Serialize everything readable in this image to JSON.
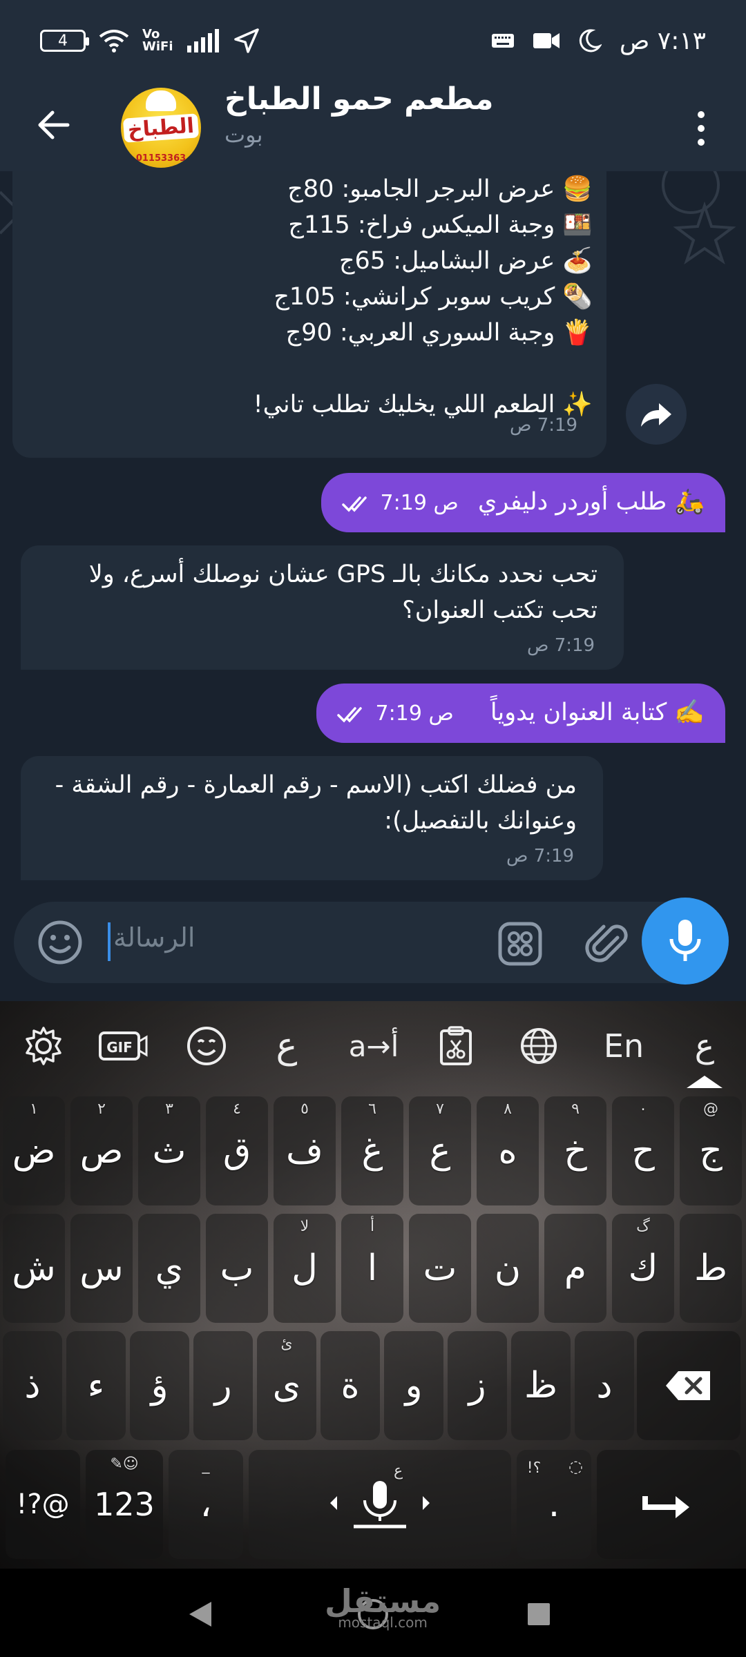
{
  "status_bar": {
    "time": "٧:١٣ ص",
    "battery": "4",
    "vowifi": "Vo\nWiFi"
  },
  "header": {
    "title": "مطعم حمو الطباخ",
    "subtitle": "بوت",
    "avatar_text": "الطباخ",
    "avatar_phone": "01153363"
  },
  "messages": {
    "menu": {
      "lines": [
        "🍔 عرض البرجر الجامبو: 80ج",
        "🍱 وجبة الميكس فراخ: 115ج",
        "🍝 عرض البشاميل: 65ج",
        "🌯 كريب سوبر كرانشي: 105ج",
        "🍟 وجبة السوري العربي: 90ج",
        "✨ الطعم اللي يخليك تطلب تاني!"
      ],
      "time": "7:19 ص"
    },
    "order": {
      "text": "🛵 طلب أوردر دليفري",
      "time": "7:19 ص"
    },
    "gps": {
      "lines": [
        "تحب نحدد مكانك بالـ GPS عشان نوصلك أسرع، ولا",
        "تحب تكتب العنوان؟"
      ],
      "time": "7:19 ص"
    },
    "manual": {
      "text": "✍️ كتابة العنوان يدوياً",
      "time": "7:19 ص"
    },
    "details": {
      "lines": [
        "من فضلك اكتب (الاسم - رقم العمارة - رقم الشقة -",
        "وعنوانك بالتفصيل):"
      ],
      "time": "7:19 ص"
    }
  },
  "composer": {
    "placeholder": "الرسالة"
  },
  "keyboard": {
    "toolbar": {
      "translate": "a→أ",
      "lang": "En",
      "ain": "ع",
      "ain2": "ع"
    },
    "row1": [
      {
        "k": "ض",
        "h": "١"
      },
      {
        "k": "ص",
        "h": "٢"
      },
      {
        "k": "ث",
        "h": "٣"
      },
      {
        "k": "ق",
        "h": "٤"
      },
      {
        "k": "ف",
        "h": "٥"
      },
      {
        "k": "غ",
        "h": "٦"
      },
      {
        "k": "ع",
        "h": "٧"
      },
      {
        "k": "ه",
        "h": "٨"
      },
      {
        "k": "خ",
        "h": "٩"
      },
      {
        "k": "ح",
        "h": "٠"
      },
      {
        "k": "ج",
        "h": "@"
      }
    ],
    "row2": [
      {
        "k": "ش",
        "h": ""
      },
      {
        "k": "س",
        "h": ""
      },
      {
        "k": "ي",
        "h": ""
      },
      {
        "k": "ب",
        "h": ""
      },
      {
        "k": "ل",
        "h": "لا"
      },
      {
        "k": "ا",
        "h": "أ"
      },
      {
        "k": "ت",
        "h": ""
      },
      {
        "k": "ن",
        "h": ""
      },
      {
        "k": "م",
        "h": ""
      },
      {
        "k": "ك",
        "h": "گ"
      },
      {
        "k": "ط",
        "h": ""
      }
    ],
    "row3": [
      {
        "k": "ذ",
        "h": ""
      },
      {
        "k": "ء",
        "h": ""
      },
      {
        "k": "ؤ",
        "h": ""
      },
      {
        "k": "ر",
        "h": ""
      },
      {
        "k": "ى",
        "h": "ئ"
      },
      {
        "k": "ة",
        "h": ""
      },
      {
        "k": "و",
        "h": ""
      },
      {
        "k": "ز",
        "h": ""
      },
      {
        "k": "ظ",
        "h": ""
      },
      {
        "k": "د",
        "h": ""
      }
    ],
    "row4": {
      "symbols": "!?@",
      "numbers": "123",
      "comma": "،",
      "comma_hint": "_",
      "space_hint": "ع",
      "period": ".",
      "period_hint": "!؟"
    }
  },
  "watermark": {
    "main": "مستقل",
    "sub": "mostaql.com"
  }
}
